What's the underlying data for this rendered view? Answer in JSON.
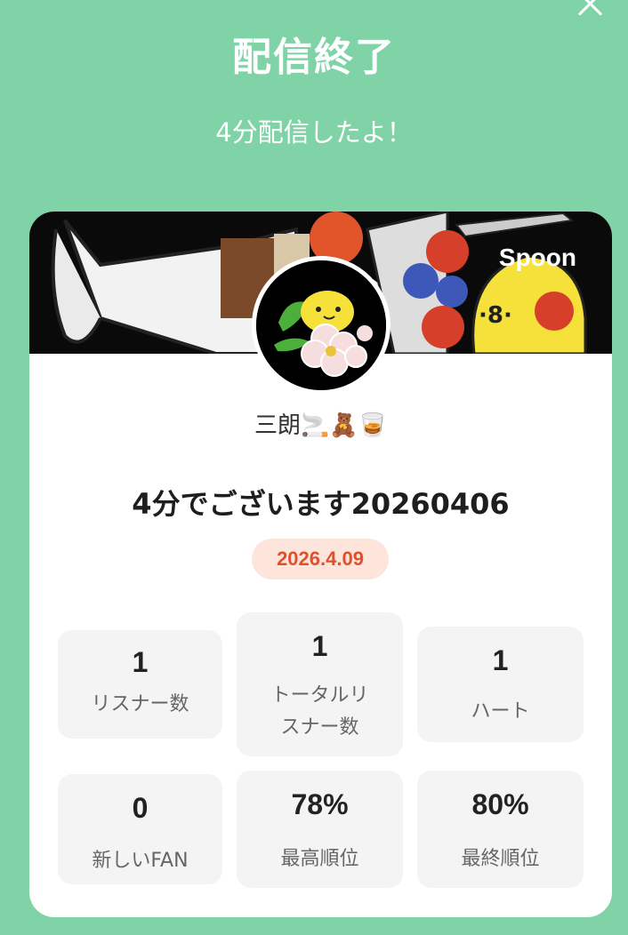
{
  "header": {
    "title": "配信終了",
    "subtitle": "4分配信したよ！"
  },
  "card": {
    "brand": "Spoon",
    "username": "三朗🚬🧸🥃",
    "stream_title": "4分でございます20260406",
    "date": "2026.4.09",
    "stats": [
      {
        "value": "1",
        "label": "リスナー数"
      },
      {
        "value": "1",
        "label_line1": "トータルリ",
        "label_line2": "スナー数"
      },
      {
        "value": "1",
        "label": "ハート"
      },
      {
        "value": "0",
        "label": "新しいFAN"
      },
      {
        "value": "78%",
        "label": "最高順位"
      },
      {
        "value": "80%",
        "label": "最終順位"
      }
    ]
  },
  "colors": {
    "background": "#7fd3a6",
    "card": "#ffffff",
    "date_badge_bg": "#fde5dc",
    "date_badge_text": "#e0502a",
    "stat_box": "#f4f4f4"
  }
}
